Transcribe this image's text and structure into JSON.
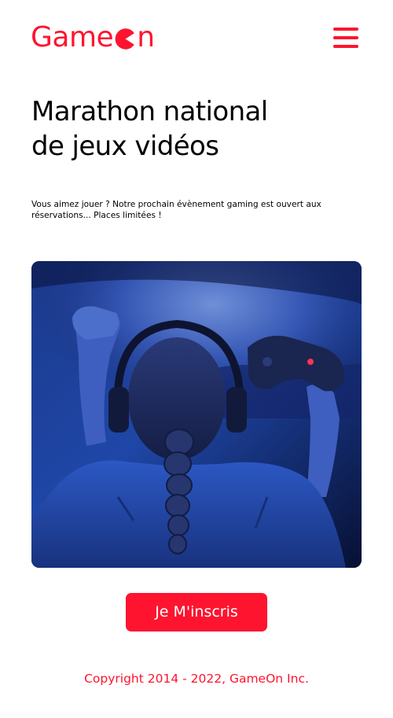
{
  "header": {
    "logo": {
      "text_before": "Game",
      "icon": "pacman-o-icon",
      "text_after": "n"
    },
    "menu_icon": "hamburger-menu-icon"
  },
  "hero": {
    "title_line1": "Marathon national",
    "title_line2": "de jeux vidéos",
    "description": "Vous aimez jouer ? Notre prochain évènement gaming est ouvert aux réservations... Places limitées !",
    "image_subject": "girl-with-headphones-holding-game-controller"
  },
  "cta": {
    "label": "Je M'inscris"
  },
  "footer": {
    "copyright": "Copyright 2014 - 2022, GameOn Inc."
  },
  "colors": {
    "brand": "#fe142f",
    "text": "#000000",
    "background": "#ffffff"
  }
}
